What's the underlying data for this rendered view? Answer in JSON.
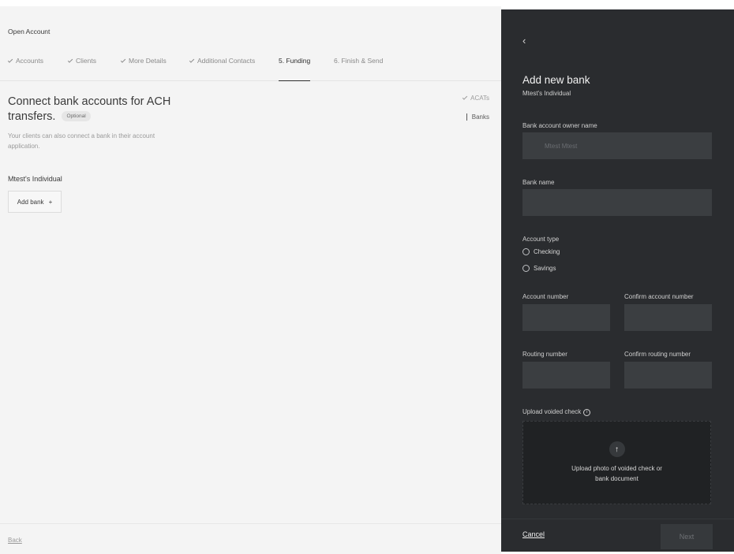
{
  "page": {
    "title": "Open Account",
    "steps": [
      {
        "label": "Accounts",
        "done": true
      },
      {
        "label": "Clients",
        "done": true
      },
      {
        "label": "More Details",
        "done": true
      },
      {
        "label": "Additional Contacts",
        "done": true
      },
      {
        "label": "5. Funding",
        "active": true
      },
      {
        "label": "6. Finish & Send"
      }
    ],
    "heading": "Connect bank accounts for ACH transfers.",
    "badge": "Optional",
    "subtext": "Your clients can also connect a bank in their account application.",
    "side_nav": {
      "acats": "ACATs",
      "banks": "Banks"
    },
    "account_name": "Mtest's Individual",
    "add_bank_label": "Add bank",
    "add_icon": "+",
    "back_label": "Back"
  },
  "drawer": {
    "back_icon": "‹",
    "title": "Add new bank",
    "subtitle": "Mtest's Individual",
    "owner_label": "Bank account owner name",
    "owner_placeholder": "Mtest Mtest",
    "bank_name_label": "Bank name",
    "account_type_label": "Account type",
    "account_types": [
      "Checking",
      "Savings"
    ],
    "account_number_label": "Account number",
    "confirm_account_number_label": "Confirm account number",
    "routing_number_label": "Routing number",
    "confirm_routing_number_label": "Confirm routing number",
    "upload_label": "Upload voided check",
    "info_icon": "i",
    "upload_arrow": "↑",
    "upload_text": "Upload photo of voided check or bank document",
    "cancel_label": "Cancel",
    "next_label": "Next"
  }
}
